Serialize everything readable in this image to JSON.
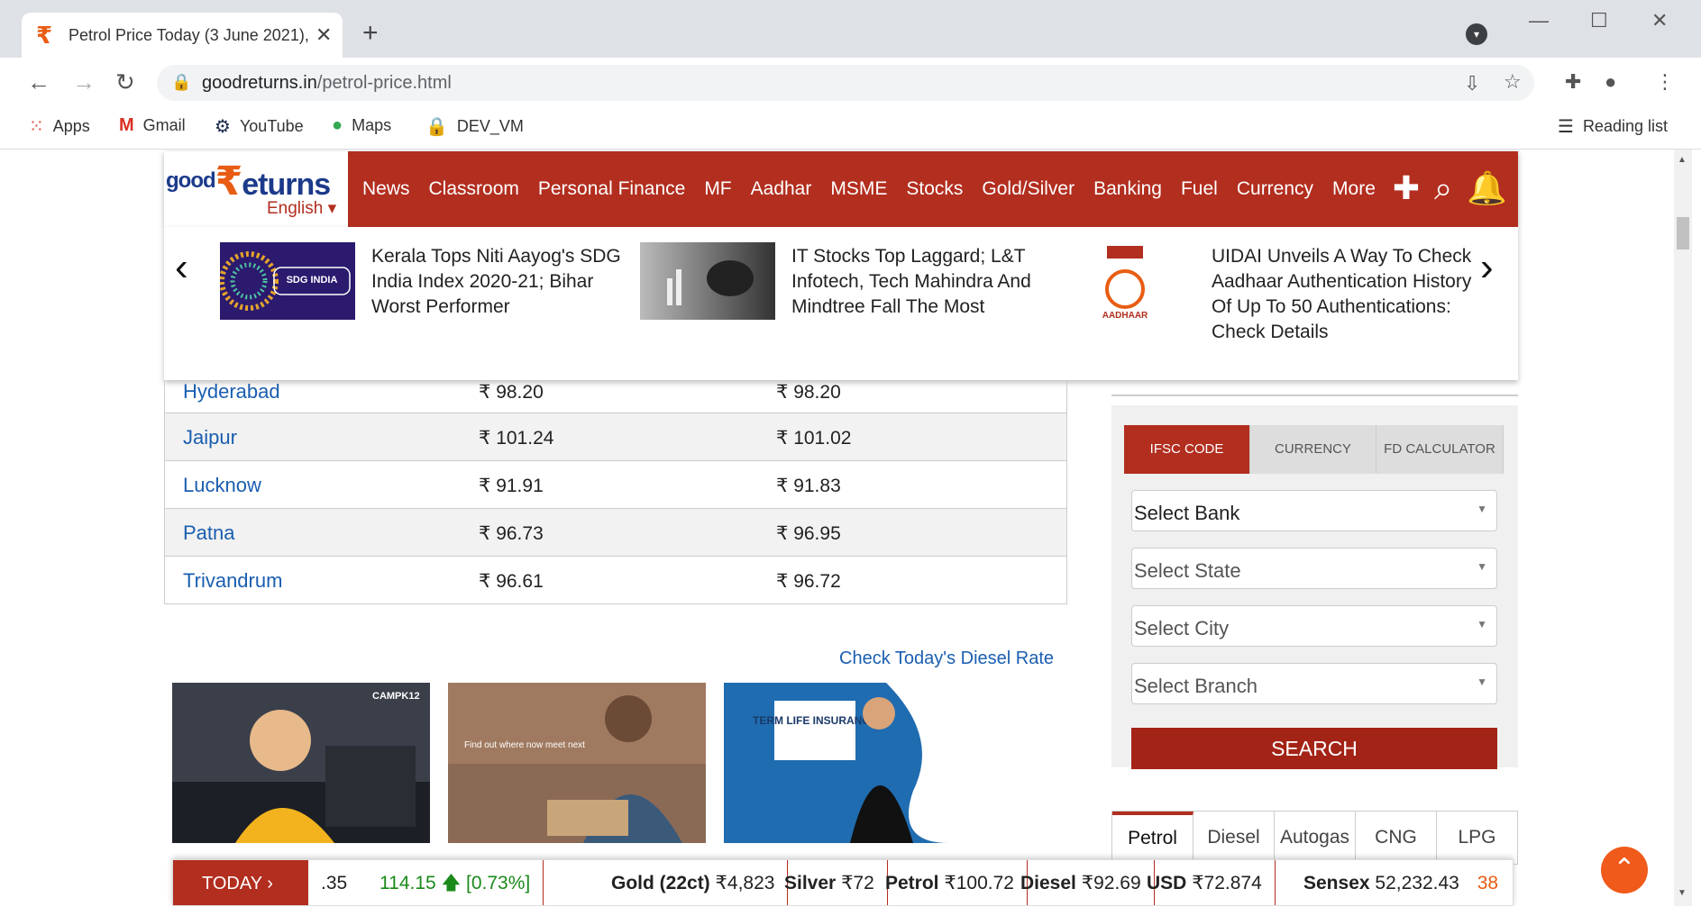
{
  "browser": {
    "tab_title": "Petrol Price Today (3 June 2021),",
    "url_domain": "goodreturns.in",
    "url_path": "/petrol-price.html",
    "bookmarks": [
      "Apps",
      "Gmail",
      "YouTube",
      "Maps",
      "DEV_VM"
    ],
    "reading_list": "Reading list"
  },
  "site": {
    "logo_good": "good",
    "logo_returns": "eturns",
    "logo_r": "₹",
    "language": "English",
    "nav": [
      "News",
      "Classroom",
      "Personal Finance",
      "MF",
      "Aadhar",
      "MSME",
      "Stocks",
      "Gold/Silver",
      "Banking",
      "Fuel",
      "Currency",
      "More"
    ]
  },
  "news": [
    {
      "headline": "Kerala Tops Niti Aayog's SDG India Index 2020-21; Bihar Worst Performer",
      "image_label": "SDG INDIA"
    },
    {
      "headline": "IT Stocks Top Laggard; L&T Infotech, Tech Mahindra And Mindtree Fall The Most",
      "image_label": ""
    },
    {
      "headline": "UIDAI Unveils A Way To Check Aadhaar Authentication History Of Up To 50 Authentications: Check Details",
      "image_label": "AADHAAR"
    }
  ],
  "price_table": {
    "rows": [
      {
        "city": "Hyderabad",
        "today": "₹ 98.20",
        "yesterday": "₹ 98.20"
      },
      {
        "city": "Jaipur",
        "today": "₹ 101.24",
        "yesterday": "₹ 101.02"
      },
      {
        "city": "Lucknow",
        "today": "₹ 91.91",
        "yesterday": "₹ 91.83"
      },
      {
        "city": "Patna",
        "today": "₹ 96.73",
        "yesterday": "₹ 96.95"
      },
      {
        "city": "Trivandrum",
        "today": "₹ 96.61",
        "yesterday": "₹ 96.72"
      }
    ]
  },
  "diesel_link": "Check Today's Diesel Rate",
  "ads": [
    {
      "text": "CAMPK12"
    },
    {
      "text": "Find out where now meet next"
    },
    {
      "text": "TERM LIFE INSURANCE"
    }
  ],
  "widget": {
    "tabs": [
      "IFSC CODE",
      "CURRENCY",
      "FD CALCULATOR"
    ],
    "select_bank": "Select Bank",
    "select_state": "Select State",
    "select_city": "Select City",
    "select_branch": "Select Branch",
    "search": "SEARCH"
  },
  "fuel_tabs": [
    "Petrol",
    "Diesel",
    "Autogas",
    "CNG",
    "LPG"
  ],
  "ticker": {
    "today": "TODAY",
    "partial_value": ".35",
    "change_value": "114.15",
    "change_pct": "[0.73%]",
    "gold_label": "Gold (22ct)",
    "gold_value": "₹4,823",
    "silver_label": "Silver",
    "silver_value": "₹72",
    "petrol_label": "Petrol",
    "petrol_value": "₹100.72",
    "diesel_label": "Diesel",
    "diesel_value": "₹92.69",
    "usd_label": "USD",
    "usd_value": "₹72.874",
    "sensex_label": "Sensex",
    "sensex_value": "52,232.43",
    "next_value": "38"
  },
  "colors": {
    "brand": "#b22e1f",
    "link": "#1a5eb0",
    "up": "#1a8a1a",
    "accent": "#e85d13"
  }
}
